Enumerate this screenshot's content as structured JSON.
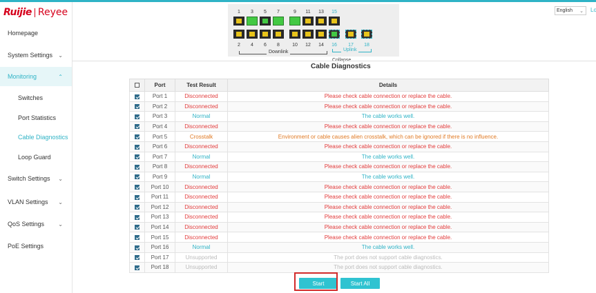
{
  "brand": {
    "logo_left": "Ruijie",
    "logo_right": "Reyee"
  },
  "sidebar": {
    "items": [
      {
        "label": "Homepage",
        "chevron": ""
      },
      {
        "label": "System Settings",
        "chevron": "⌄"
      },
      {
        "label": "Monitoring",
        "chevron": "⌃"
      },
      {
        "label": "Switches",
        "chevron": ""
      },
      {
        "label": "Port Statistics",
        "chevron": ""
      },
      {
        "label": "Cable Diagnostics",
        "chevron": ""
      },
      {
        "label": "Loop Guard",
        "chevron": ""
      },
      {
        "label": "Switch Settings",
        "chevron": "⌄"
      },
      {
        "label": "VLAN Settings",
        "chevron": "⌄"
      },
      {
        "label": "QoS Settings",
        "chevron": "⌄"
      },
      {
        "label": "PoE Settings",
        "chevron": ""
      }
    ]
  },
  "header": {
    "language": "English",
    "logout": "Lo"
  },
  "panel": {
    "top_numbers": [
      "1",
      "3",
      "5",
      "7",
      "9",
      "11",
      "13",
      "15"
    ],
    "bottom_numbers": [
      "2",
      "4",
      "6",
      "8",
      "10",
      "12",
      "14",
      "16",
      "17",
      "18"
    ],
    "downlink_label": "Downlink",
    "uplink_label": "Uplink",
    "collapse_label": "Collapse"
  },
  "page": {
    "title": "Cable Diagnostics"
  },
  "table": {
    "headers": {
      "port": "Port",
      "result": "Test Result",
      "details": "Details"
    },
    "rows": [
      {
        "port": "Port 1",
        "result": "Disconnected",
        "details": "Please check cable connection or replace the cable."
      },
      {
        "port": "Port 2",
        "result": "Disconnected",
        "details": "Please check cable connection or replace the cable."
      },
      {
        "port": "Port 3",
        "result": "Normal",
        "details": "The cable works well."
      },
      {
        "port": "Port 4",
        "result": "Disconnected",
        "details": "Please check cable connection or replace the cable."
      },
      {
        "port": "Port 5",
        "result": "Crosstalk",
        "details": "Environment or cable causes alien crosstalk, which can be ignored if there is no influence."
      },
      {
        "port": "Port 6",
        "result": "Disconnected",
        "details": "Please check cable connection or replace the cable."
      },
      {
        "port": "Port 7",
        "result": "Normal",
        "details": "The cable works well."
      },
      {
        "port": "Port 8",
        "result": "Disconnected",
        "details": "Please check cable connection or replace the cable."
      },
      {
        "port": "Port 9",
        "result": "Normal",
        "details": "The cable works well."
      },
      {
        "port": "Port 10",
        "result": "Disconnected",
        "details": "Please check cable connection or replace the cable."
      },
      {
        "port": "Port 11",
        "result": "Disconnected",
        "details": "Please check cable connection or replace the cable."
      },
      {
        "port": "Port 12",
        "result": "Disconnected",
        "details": "Please check cable connection or replace the cable."
      },
      {
        "port": "Port 13",
        "result": "Disconnected",
        "details": "Please check cable connection or replace the cable."
      },
      {
        "port": "Port 14",
        "result": "Disconnected",
        "details": "Please check cable connection or replace the cable."
      },
      {
        "port": "Port 15",
        "result": "Disconnected",
        "details": "Please check cable connection or replace the cable."
      },
      {
        "port": "Port 16",
        "result": "Normal",
        "details": "The cable works well."
      },
      {
        "port": "Port 17",
        "result": "Unsupported",
        "details": "The port does not support cable diagnostics."
      },
      {
        "port": "Port 18",
        "result": "Unsupported",
        "details": "The port does not support cable diagnostics."
      }
    ]
  },
  "buttons": {
    "start": "Start",
    "start_all": "Start All"
  },
  "colors": {
    "accent": "#2fb3c6",
    "error": "#e23c3c",
    "warning": "#e07a24",
    "disabled": "#bbbbbb",
    "brand": "#d6001c"
  }
}
